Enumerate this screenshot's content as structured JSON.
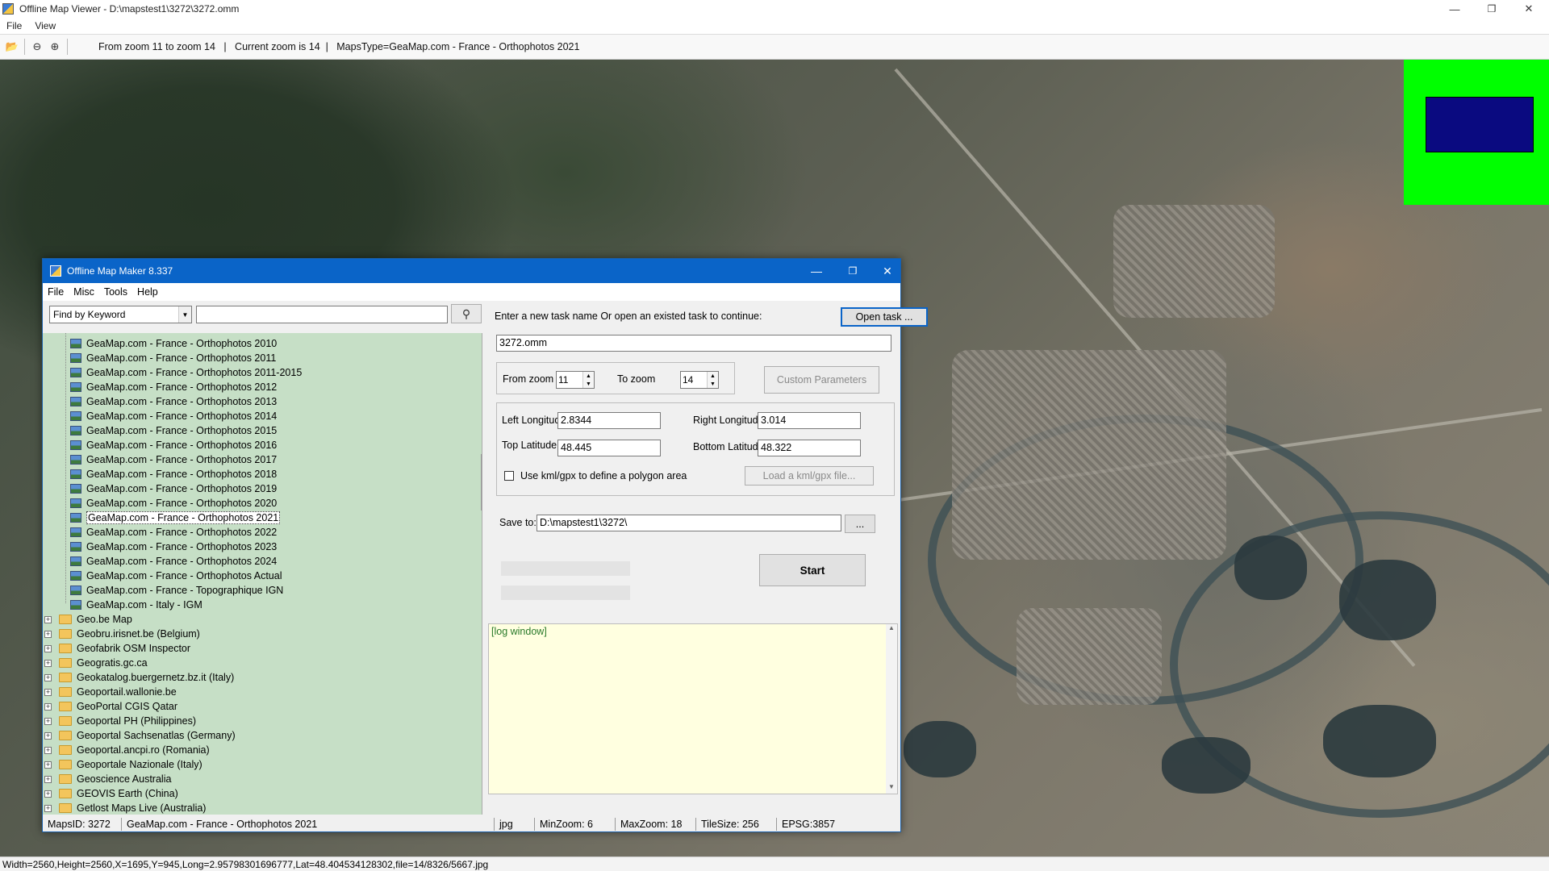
{
  "window": {
    "title": "Offline Map Viewer - D:\\mapstest1\\3272\\3272.omm",
    "controls": {
      "minimize": "—",
      "maximize": "❐",
      "close": "✕"
    }
  },
  "menu": {
    "file": "File",
    "view": "View"
  },
  "toolbar": {
    "status": "From zoom 11 to zoom 14   |   Current zoom is 14  |   MapsType=GeaMap.com - France - Orthophotos 2021"
  },
  "bottom_status": "Width=2560,Height=2560,X=1695,Y=945,Long=2.95798301696777,Lat=48.404534128302,file=14/8326/5667.jpg",
  "colors": {
    "dialog_titlebar": "#0a64c8",
    "tree_bg": "#c6dfc6",
    "minimap_bg": "#00ff00",
    "minimap_viewport": "#0a0a80",
    "log_bg": "#ffffe0"
  },
  "dialog": {
    "title": "Offline Map Maker 8.337",
    "menu": [
      "File",
      "Misc",
      "Tools",
      "Help"
    ],
    "search": {
      "combo_value": "Find by Keyword",
      "keyword_value": "",
      "icon": "search-icon"
    },
    "tree": {
      "children": [
        "GeaMap.com - France - Orthophotos 2010",
        "GeaMap.com - France - Orthophotos 2011",
        "GeaMap.com - France - Orthophotos 2011-2015",
        "GeaMap.com - France - Orthophotos 2012",
        "GeaMap.com - France - Orthophotos 2013",
        "GeaMap.com - France - Orthophotos 2014",
        "GeaMap.com - France - Orthophotos 2015",
        "GeaMap.com - France - Orthophotos 2016",
        "GeaMap.com - France - Orthophotos 2017",
        "GeaMap.com - France - Orthophotos 2018",
        "GeaMap.com - France - Orthophotos 2019",
        "GeaMap.com - France - Orthophotos 2020",
        "GeaMap.com - France - Orthophotos 2021",
        "GeaMap.com - France - Orthophotos 2022",
        "GeaMap.com - France - Orthophotos 2023",
        "GeaMap.com - France - Orthophotos 2024",
        "GeaMap.com - France - Orthophotos Actual",
        "GeaMap.com - France - Topographique IGN",
        "GeaMap.com - Italy - IGM"
      ],
      "selected": "GeaMap.com - France - Orthophotos 2021",
      "folders": [
        "Geo.be Map",
        "Geobru.irisnet.be (Belgium)",
        "Geofabrik OSM Inspector",
        "Geogratis.gc.ca",
        "Geokatalog.buergernetz.bz.it (Italy)",
        "Geoportail.wallonie.be",
        "GeoPortal CGIS Qatar",
        "Geoportal PH (Philippines)",
        "Geoportal Sachsenatlas (Germany)",
        "Geoportal.ancpi.ro (Romania)",
        "Geoportale Nazionale (Italy)",
        "Geoscience Australia",
        "GEOVIS Earth (China)",
        "Getlost Maps Live (Australia)"
      ]
    },
    "task": {
      "prompt": "Enter a new task name Or open an existed task to continue:",
      "open_button": "Open task ...",
      "name_value": "3272.omm"
    },
    "zoom": {
      "from_label": "From zoom",
      "from_value": "11",
      "to_label": "To zoom",
      "to_value": "14",
      "custom_button": "Custom Parameters"
    },
    "coords": {
      "left_lon_label": "Left Longitude",
      "left_lon_value": "2.8344",
      "right_lon_label": "Right Longitude",
      "right_lon_value": "3.014",
      "top_lat_label": "Top Latitude",
      "top_lat_value": "48.445",
      "bottom_lat_label": "Bottom Latitude",
      "bottom_lat_value": "48.322",
      "kml_checkbox_label": "Use kml/gpx to define a polygon area",
      "kml_checked": false,
      "kml_button": "Load a kml/gpx file..."
    },
    "save": {
      "label": "Save to:",
      "value": "D:\\mapstest1\\3272\\",
      "browse_button": "..."
    },
    "start_button": "Start",
    "log_text": "[log window]",
    "status": {
      "maps_id": "MapsID: 3272",
      "map_name": "GeaMap.com - France - Orthophotos 2021",
      "format": "jpg",
      "min_zoom": "MinZoom: 6",
      "max_zoom": "MaxZoom: 18",
      "tile_size": "TileSize: 256",
      "epsg": "EPSG:3857"
    }
  }
}
